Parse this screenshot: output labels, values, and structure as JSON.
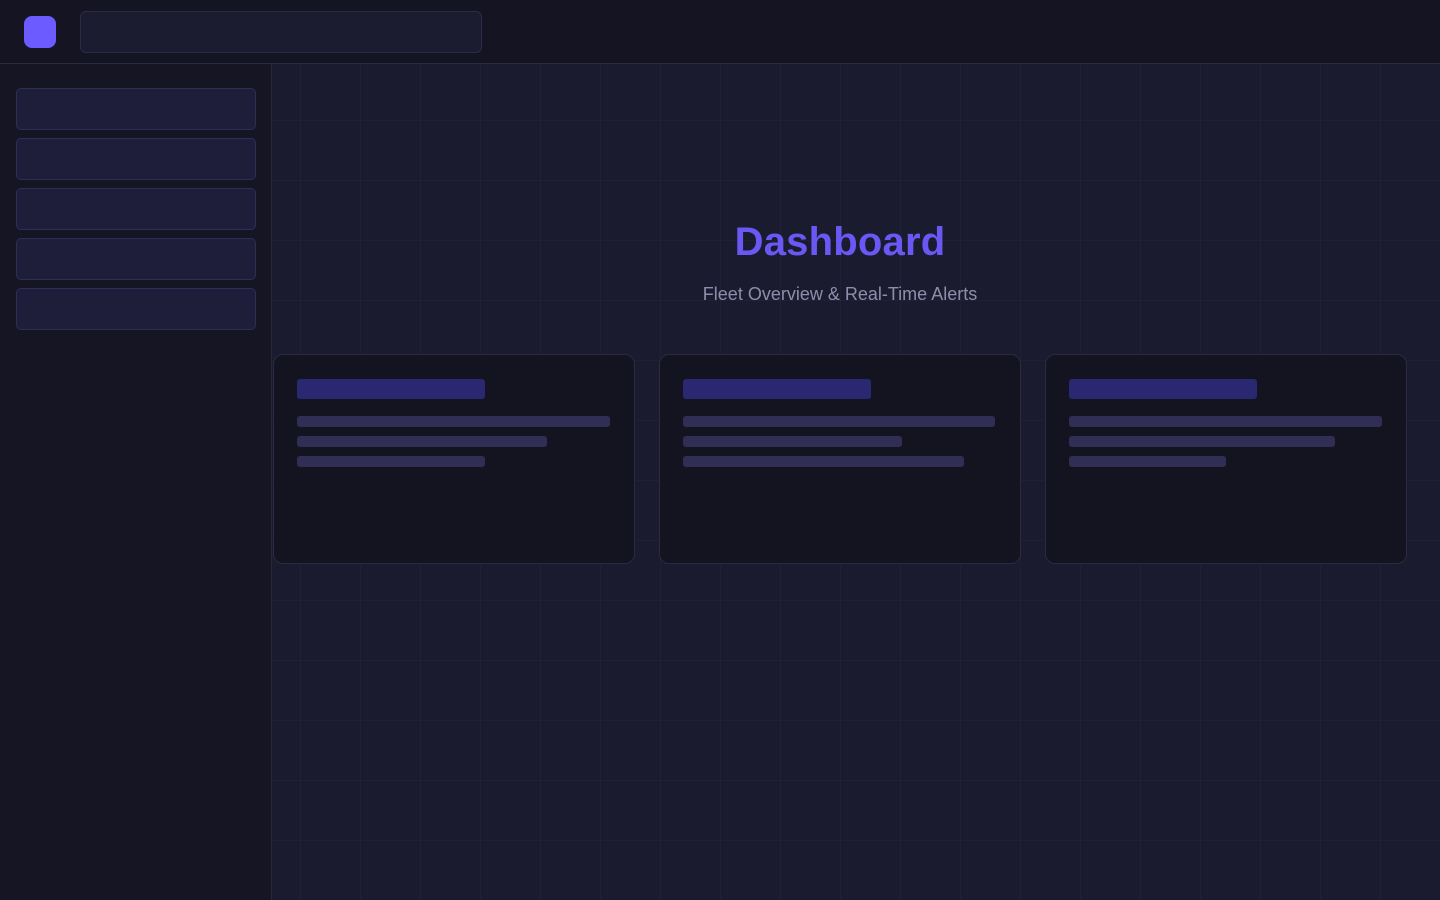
{
  "header": {
    "logo_icon": "app-logo-icon",
    "search": {
      "value": "",
      "placeholder": ""
    }
  },
  "sidebar": {
    "items": [
      {
        "label": ""
      },
      {
        "label": ""
      },
      {
        "label": ""
      },
      {
        "label": ""
      },
      {
        "label": ""
      }
    ]
  },
  "main": {
    "title": "Dashboard",
    "subtitle": "Fleet Overview & Real-Time Alerts"
  },
  "colors": {
    "accent": "#6c5cff",
    "title": "#6a58f5",
    "background": "#1b1b2f",
    "placeholder_title": "#2a2870",
    "placeholder_line": "#302e54"
  }
}
